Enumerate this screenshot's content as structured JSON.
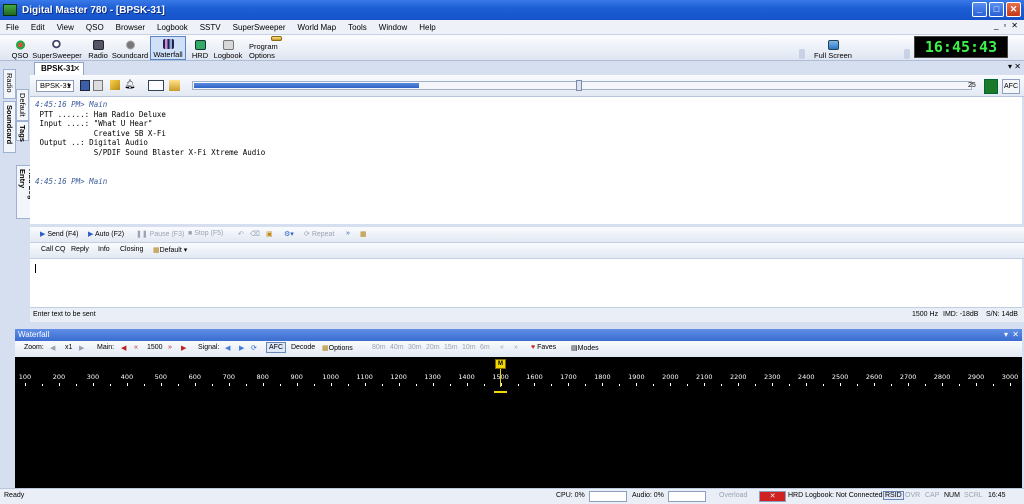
{
  "window": {
    "title": "Digital Master 780 - [BPSK-31]"
  },
  "menu": [
    "File",
    "Edit",
    "View",
    "QSO",
    "Browser",
    "Logbook",
    "SSTV",
    "SuperSweeper",
    "World Map",
    "Tools",
    "Window",
    "Help"
  ],
  "toolbar": {
    "buttons": [
      "QSO",
      "SuperSweeper",
      "Radio",
      "Soundcard",
      "Waterfall",
      "HRD",
      "Logbook",
      "Program Options"
    ],
    "fullscreen_label": "Full Screen",
    "clock": "16:45:43"
  },
  "sidetabs": {
    "radio": "Radio",
    "soundcard": "Soundcard",
    "default": "Default",
    "tags": "Tags",
    "add_log": "Add Log Entry"
  },
  "doc_tab": {
    "label": "BPSK-31"
  },
  "modebar": {
    "mode": "BPSK-31",
    "value": "25",
    "afc": "AFC",
    "progress": 0.29
  },
  "rx": {
    "lines": [
      {
        "ts": "4:45:16 PM> Main",
        "text": ""
      },
      {
        "ts": "",
        "text": " PTT ......: Ham Radio Deluxe"
      },
      {
        "ts": "",
        "text": " Input ....: \"What U Hear\""
      },
      {
        "ts": "",
        "text": "             Creative SB X-Fi"
      },
      {
        "ts": "",
        "text": " Output ..: Digital Audio"
      },
      {
        "ts": "",
        "text": "             S/PDIF Sound Blaster X-Fi Xtreme Audio"
      },
      {
        "ts": "",
        "text": ""
      },
      {
        "ts": "",
        "text": ""
      },
      {
        "ts": "4:45:16 PM> Main",
        "text": ""
      }
    ]
  },
  "tx": {
    "send": "Send (F4)",
    "auto": "Auto (F2)",
    "pause": "Pause (F3)",
    "stop": "Stop (F5)",
    "repeat": "Repeat",
    "macros": [
      "Call CQ",
      "Reply",
      "Info",
      "Closing"
    ],
    "macro_set": "Default",
    "status_left": "Enter text to be sent",
    "freq": "1500 Hz",
    "imd": "IMD: -18dB",
    "sn": "S/N: 14dB"
  },
  "waterfall": {
    "title": "Waterfall",
    "zoom_label": "Zoom:",
    "zoom_value": "x1",
    "main_label": "Main:",
    "main_value": "1500",
    "signal_label": "Signal:",
    "afc": "AFC",
    "decode": "Decode",
    "options": "Options",
    "bands": [
      "80m",
      "40m",
      "30m",
      "20m",
      "15m",
      "10m",
      "6m"
    ],
    "faves": "Faves",
    "modes": "Modes",
    "marker": "M",
    "scale": [
      "100",
      "200",
      "300",
      "400",
      "500",
      "600",
      "700",
      "800",
      "900",
      "1000",
      "1100",
      "1200",
      "1300",
      "1400",
      "1500",
      "1600",
      "1700",
      "1800",
      "1900",
      "2000",
      "2100",
      "2200",
      "2300",
      "2400",
      "2500",
      "2600",
      "2700",
      "2800",
      "2900",
      "3000"
    ]
  },
  "status": {
    "ready": "Ready",
    "cpu": "CPU: 0%",
    "audio": "Audio: 0%",
    "overload": "Overload",
    "logbook": "HRD Logbook: Not Connected",
    "rsid": "RSID",
    "ovr": "OVR",
    "cap": "CAP",
    "num": "NUM",
    "scrl": "SCRL",
    "time": "16:45"
  },
  "colors": {
    "title_bar": "#1d5fd6",
    "clock_text": "#3ef04a",
    "marker": "#f0d800"
  }
}
